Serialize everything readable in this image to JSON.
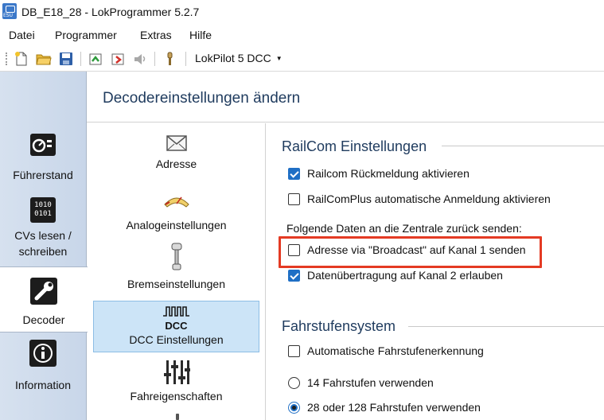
{
  "window": {
    "title": "DB_E18_28 - LokProgrammer 5.2.7"
  },
  "menu": {
    "items": [
      "Datei",
      "Programmer",
      "Extras",
      "Hilfe"
    ]
  },
  "toolbar": {
    "buttons": [
      "new-file-icon",
      "open-folder-icon",
      "save-icon",
      "read-decoder-icon",
      "write-decoder-icon",
      "play-sound-icon",
      "wrench-icon"
    ],
    "decoder_select": "LokPilot 5 DCC"
  },
  "leftnav": {
    "items": [
      {
        "label": "Führerstand",
        "icon": "cab-control-icon",
        "active": false
      },
      {
        "label": "CVs lesen / schreiben",
        "icon": "binary-data-icon",
        "active": false
      },
      {
        "label": "Decoder",
        "icon": "wrench-tool-icon",
        "active": true
      },
      {
        "label": "Information",
        "icon": "info-icon",
        "active": false
      }
    ]
  },
  "header": {
    "title": "Decodereinstellungen ändern"
  },
  "categories": {
    "items": [
      {
        "label": "Adresse",
        "icon": "envelope-icon",
        "active": false
      },
      {
        "label": "Analogeinstellungen",
        "icon": "gauge-icon",
        "active": false
      },
      {
        "label": "Bremseinstellungen",
        "icon": "brake-icon",
        "active": false
      },
      {
        "label": "DCC Einstellungen",
        "icon": "dcc-signal-icon",
        "icon_text": "DCC",
        "active": true
      },
      {
        "label": "Fahreigenschaften",
        "icon": "sliders-icon",
        "active": false
      }
    ]
  },
  "railcom": {
    "title": "RailCom Einstellungen",
    "options": [
      {
        "label": "Railcom Rückmeldung aktivieren",
        "checked": true
      },
      {
        "label": "RailComPlus automatische Anmeldung aktivieren",
        "checked": false
      }
    ],
    "send_heading": "Folgende Daten an die Zentrale zurück senden:",
    "send_options": [
      {
        "label": "Adresse via \"Broadcast\" auf Kanal 1 senden",
        "checked": false,
        "highlighted": true
      },
      {
        "label": "Datenübertragung auf Kanal 2 erlauben",
        "checked": true
      }
    ]
  },
  "fahrstufen": {
    "title": "Fahrstufensystem",
    "auto_detect": {
      "label": "Automatische Fahrstufenerkennung",
      "checked": false
    },
    "radios": [
      {
        "label": "14 Fahrstufen verwenden",
        "selected": false
      },
      {
        "label": "28 oder 128 Fahrstufen verwenden",
        "selected": true
      }
    ]
  },
  "colors": {
    "accent": "#1f6fc5",
    "header_text": "#1f3b5e",
    "highlight": "#e43a23",
    "selected_bg": "#cce4f7"
  }
}
